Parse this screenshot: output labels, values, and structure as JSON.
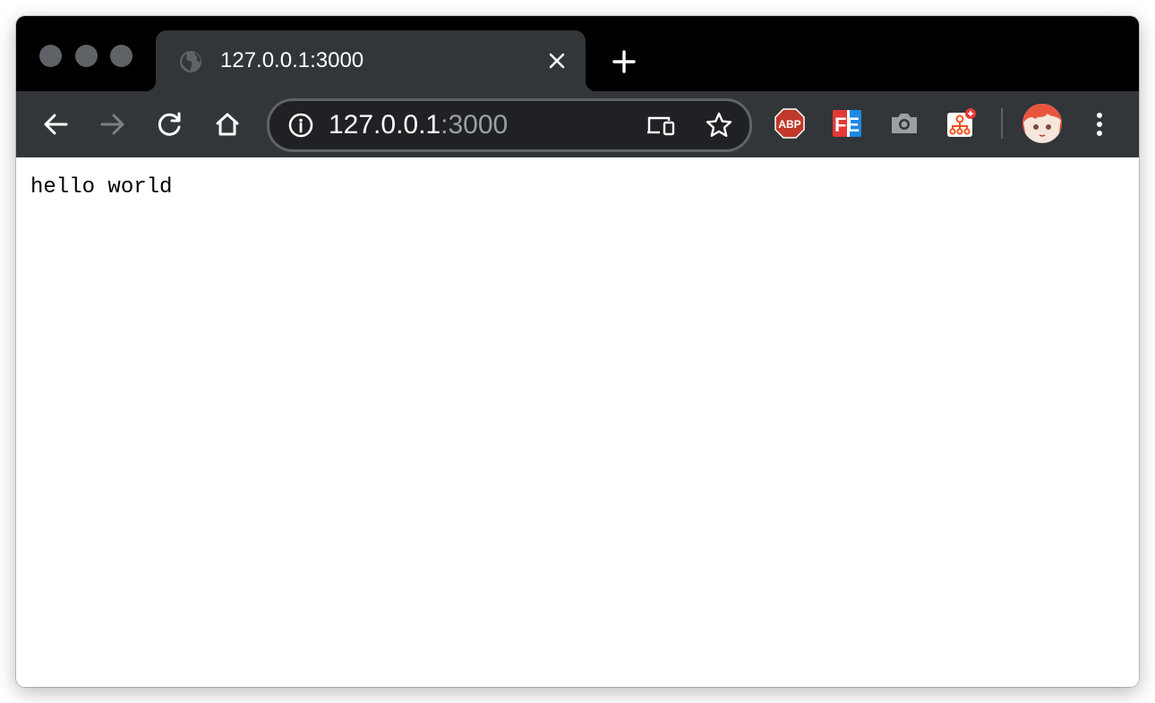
{
  "tab": {
    "title": "127.0.0.1:3000",
    "favicon": "globe-icon",
    "close_icon": "close-icon"
  },
  "new_tab_icon": "plus-icon",
  "nav": {
    "back_icon": "arrow-left-icon",
    "forward_icon": "arrow-right-icon",
    "reload_icon": "reload-icon",
    "home_icon": "home-icon"
  },
  "omnibox": {
    "info_icon": "info-icon",
    "host": "127.0.0.1",
    "port": ":3000",
    "cast_icon": "devices-icon",
    "bookmark_icon": "star-icon"
  },
  "extensions": [
    {
      "name": "adblock-plus",
      "label": "ABP",
      "color": "#c0392b"
    },
    {
      "name": "fe-helper",
      "label": "FE",
      "color": "#e53935"
    },
    {
      "name": "screenshot",
      "icon": "camera-icon"
    },
    {
      "name": "sitemap",
      "icon": "sitemap-icon",
      "color": "#f4511e"
    }
  ],
  "page": {
    "text": "hello world"
  },
  "colors": {
    "titlebar": "#000000",
    "toolbar": "#323639",
    "omnibox": "#202124",
    "port_text": "#9aa0a6"
  }
}
